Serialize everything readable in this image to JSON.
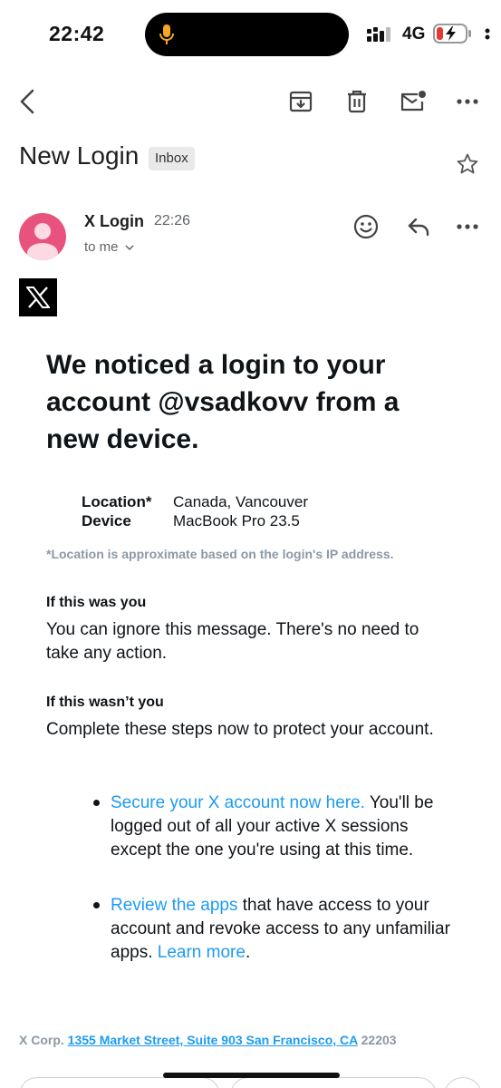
{
  "status_bar": {
    "time": "22:42",
    "network": "4G"
  },
  "subject": "New Login",
  "label_badge": "Inbox",
  "sender": {
    "name": "X Login",
    "time": "22:26",
    "to": "to me"
  },
  "email": {
    "headline": "We noticed a login to your account @vsadkovv from a new device.",
    "details": [
      {
        "label": "Location*",
        "value": "Canada, Vancouver"
      },
      {
        "label": "Device",
        "value": "MacBook Pro 23.5"
      }
    ],
    "footnote": "*Location is approximate based on the login's IP address.",
    "section_you": {
      "title": "If this was you",
      "text": "You can ignore this message. There's no need to take any action."
    },
    "section_not_you": {
      "title": "If this wasn’t you",
      "text": "Complete these steps now to protect your account."
    },
    "bullets": [
      {
        "link": "Secure your X account now here.",
        "text": " You'll be logged out of all your active X sessions except the one you're using at this time."
      },
      {
        "link": "Review the apps",
        "text": " that have access to your account and revoke access to any unfamiliar apps. ",
        "link2": "Learn more",
        "tail": "."
      }
    ],
    "footer": {
      "company": "X Corp.",
      "address": "1355 Market Street, Suite 903 San Francisco, CA",
      "zip": "22203"
    }
  },
  "colors": {
    "link": "#1d9bf0",
    "avatar": "#e8537d",
    "muted": "#8b98a5"
  }
}
